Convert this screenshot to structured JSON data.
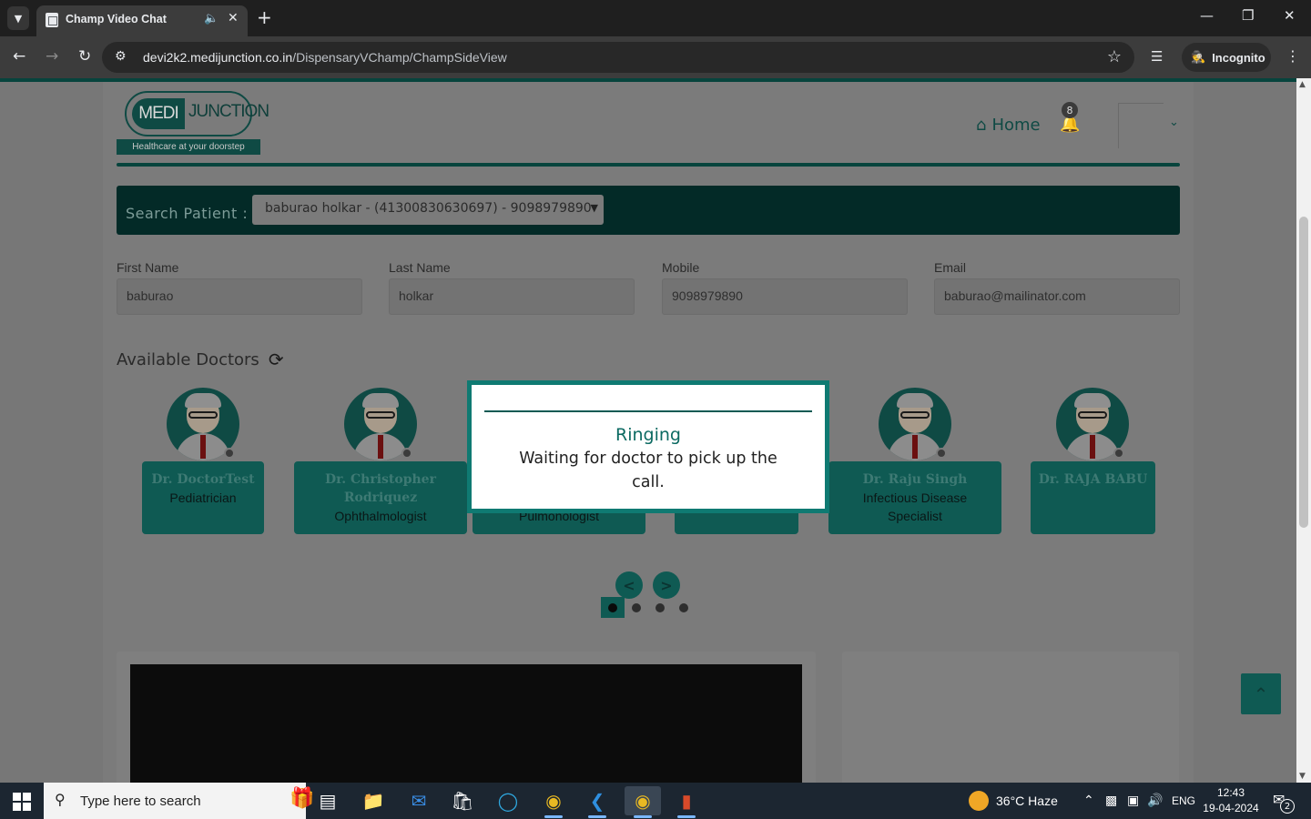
{
  "browser": {
    "tab_title": "Champ Video Chat",
    "url_host": "devi2k2.medijunction.co.in",
    "url_path": "/DispensaryVChamp/ChampSideView",
    "incognito_label": "Incognito"
  },
  "header": {
    "logo_medi": "MEDI",
    "logo_junction": "JUNCTION",
    "logo_tagline": "Healthcare at your  doorstep",
    "home_label": "Home",
    "notification_count": "8"
  },
  "search": {
    "label": "Search Patient :",
    "selected_value": "baburao holkar - (41300830630697) - 9098979890"
  },
  "patient": {
    "first_name_label": "First Name",
    "first_name": "baburao",
    "last_name_label": "Last Name",
    "last_name": "holkar",
    "mobile_label": "Mobile",
    "mobile": "9098979890",
    "email_label": "Email",
    "email": "baburao@mailinator.com"
  },
  "doctors": {
    "title": "Available Doctors",
    "list": [
      {
        "name": "Dr. DoctorTest",
        "specialty": "Pediatrician"
      },
      {
        "name": "Dr. Christopher Rodriquez",
        "specialty": "Ophthalmologist"
      },
      {
        "name": "",
        "specialty": "Pulmonologist"
      },
      {
        "name": "",
        "specialty": ""
      },
      {
        "name": "Dr. Raju Singh",
        "specialty": "Infectious Disease Specialist"
      },
      {
        "name": "Dr. RAJA BABU",
        "specialty": ""
      }
    ],
    "prev_label": "<",
    "next_label": ">"
  },
  "modal": {
    "title": "Ringing",
    "message": "Waiting for doctor to pick up the call."
  },
  "taskbar": {
    "search_placeholder": "Type here to search",
    "weather": "36°C  Haze",
    "language": "ENG",
    "time": "12:43",
    "date": "19-04-2024",
    "notification_count": "2"
  },
  "colors": {
    "brand_teal": "#0f4a44",
    "overlay_gray": "#7b7b7b",
    "modal_border": "#0f7a72"
  }
}
